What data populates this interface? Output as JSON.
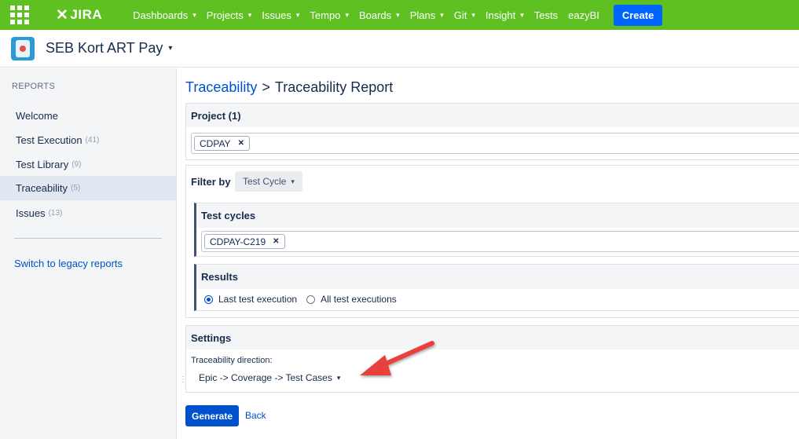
{
  "topnav": {
    "logo": "JIRA",
    "items": [
      {
        "label": "Dashboards",
        "dropdown": true
      },
      {
        "label": "Projects",
        "dropdown": true
      },
      {
        "label": "Issues",
        "dropdown": true
      },
      {
        "label": "Tempo",
        "dropdown": true
      },
      {
        "label": "Boards",
        "dropdown": true
      },
      {
        "label": "Plans",
        "dropdown": true
      },
      {
        "label": "Git",
        "dropdown": true
      },
      {
        "label": "Insight",
        "dropdown": true
      },
      {
        "label": "Tests",
        "dropdown": false
      },
      {
        "label": "eazyBI",
        "dropdown": false
      }
    ],
    "create_label": "Create"
  },
  "project": {
    "name": "SEB Kort ART Pay"
  },
  "sidebar": {
    "heading": "REPORTS",
    "items": [
      {
        "label": "Welcome",
        "count": ""
      },
      {
        "label": "Test Execution",
        "count": "(41)"
      },
      {
        "label": "Test Library",
        "count": "(9)"
      },
      {
        "label": "Traceability",
        "count": "(5)"
      },
      {
        "label": "Issues",
        "count": "(13)"
      }
    ],
    "legacy_link": "Switch to legacy reports"
  },
  "breadcrumb": {
    "parent": "Traceability",
    "separator": ">",
    "current": "Traceability Report"
  },
  "project_panel": {
    "title": "Project (1)",
    "tag": "CDPAY"
  },
  "filter_panel": {
    "label": "Filter by",
    "selected": "Test Cycle",
    "cycles_title": "Test cycles",
    "cycle_tag": "CDPAY-C219",
    "results_title": "Results",
    "options": [
      {
        "label": "Last test execution",
        "checked": true
      },
      {
        "label": "All test executions",
        "checked": false
      }
    ]
  },
  "settings_panel": {
    "title": "Settings",
    "direction_label": "Traceability direction:",
    "direction_value": "Epic -> Coverage -> Test Cases"
  },
  "actions": {
    "generate": "Generate",
    "back": "Back"
  },
  "colors": {
    "nav_bg": "#5ec121",
    "primary": "#0052cc",
    "create": "#0065ff",
    "annotation_arrow": "#e8403a"
  }
}
